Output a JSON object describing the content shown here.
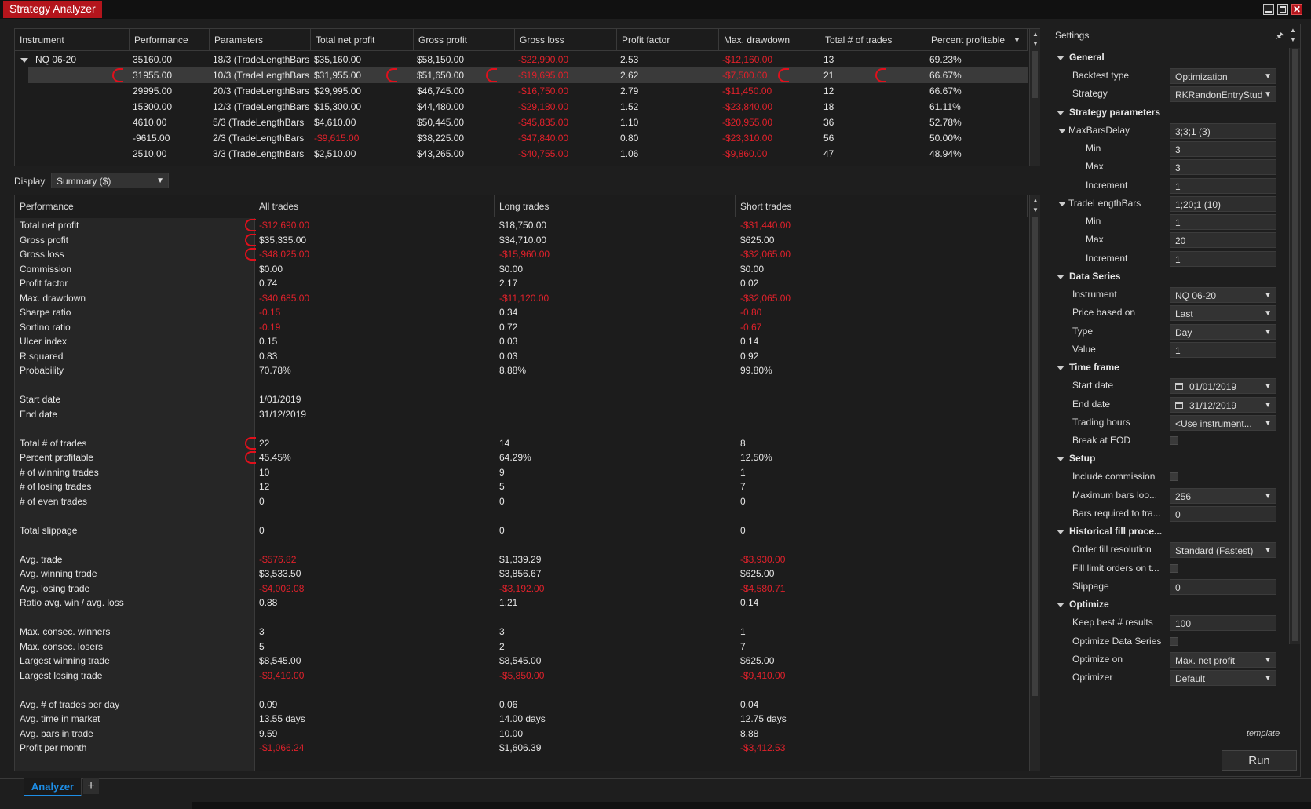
{
  "app": {
    "title": "Strategy Analyzer"
  },
  "top_table": {
    "columns": [
      "Instrument",
      "Performance",
      "Parameters",
      "Total net profit",
      "Gross profit",
      "Gross loss",
      "Profit factor",
      "Max. drawdown",
      "Total # of trades",
      "Percent profitable"
    ],
    "group": "NQ 06-20",
    "rows": [
      {
        "perf": "35160.00",
        "params": "18/3 (TradeLengthBars",
        "net": "$35,160.00",
        "gross": "$58,150.00",
        "loss": "-$22,990.00",
        "pf": "2.53",
        "dd": "-$12,160.00",
        "trades": "13",
        "pct": "69.23%"
      },
      {
        "perf": "31955.00",
        "params": "10/3 (TradeLengthBars",
        "net": "$31,955.00",
        "gross": "$51,650.00",
        "loss": "-$19,695.00",
        "pf": "2.62",
        "dd": "-$7,500.00",
        "trades": "21",
        "pct": "66.67%"
      },
      {
        "perf": "29995.00",
        "params": "20/3 (TradeLengthBars",
        "net": "$29,995.00",
        "gross": "$46,745.00",
        "loss": "-$16,750.00",
        "pf": "2.79",
        "dd": "-$11,450.00",
        "trades": "12",
        "pct": "66.67%"
      },
      {
        "perf": "15300.00",
        "params": "12/3 (TradeLengthBars",
        "net": "$15,300.00",
        "gross": "$44,480.00",
        "loss": "-$29,180.00",
        "pf": "1.52",
        "dd": "-$23,840.00",
        "trades": "18",
        "pct": "61.11%"
      },
      {
        "perf": "4610.00",
        "params": "5/3 (TradeLengthBars",
        "net": "$4,610.00",
        "gross": "$50,445.00",
        "loss": "-$45,835.00",
        "pf": "1.10",
        "dd": "-$20,955.00",
        "trades": "36",
        "pct": "52.78%"
      },
      {
        "perf": "-9615.00",
        "params": "2/3 (TradeLengthBars",
        "net": "-$9,615.00",
        "gross": "$38,225.00",
        "loss": "-$47,840.00",
        "pf": "0.80",
        "dd": "-$23,310.00",
        "trades": "56",
        "pct": "50.00%"
      },
      {
        "perf": "2510.00",
        "params": "3/3 (TradeLengthBars",
        "net": "$2,510.00",
        "gross": "$43,265.00",
        "loss": "-$40,755.00",
        "pf": "1.06",
        "dd": "-$9,860.00",
        "trades": "47",
        "pct": "48.94%"
      }
    ]
  },
  "display": {
    "label": "Display",
    "value": "Summary ($)"
  },
  "perf_table": {
    "columns": [
      "Performance",
      "All trades",
      "Long trades",
      "Short trades"
    ],
    "rows": [
      [
        "Total net profit",
        "-$12,690.00",
        "$18,750.00",
        "-$31,440.00"
      ],
      [
        "Gross profit",
        "$35,335.00",
        "$34,710.00",
        "$625.00"
      ],
      [
        "Gross loss",
        "-$48,025.00",
        "-$15,960.00",
        "-$32,065.00"
      ],
      [
        "Commission",
        "$0.00",
        "$0.00",
        "$0.00"
      ],
      [
        "Profit factor",
        "0.74",
        "2.17",
        "0.02"
      ],
      [
        "Max. drawdown",
        "-$40,685.00",
        "-$11,120.00",
        "-$32,065.00"
      ],
      [
        "Sharpe ratio",
        "-0.15",
        "0.34",
        "-0.80"
      ],
      [
        "Sortino ratio",
        "-0.19",
        "0.72",
        "-0.67"
      ],
      [
        "Ulcer index",
        "0.15",
        "0.03",
        "0.14"
      ],
      [
        "R squared",
        "0.83",
        "0.03",
        "0.92"
      ],
      [
        "Probability",
        "70.78%",
        "8.88%",
        "99.80%"
      ],
      [
        "",
        "",
        "",
        ""
      ],
      [
        "Start date",
        "1/01/2019",
        "",
        ""
      ],
      [
        "End date",
        "31/12/2019",
        "",
        ""
      ],
      [
        "",
        "",
        "",
        ""
      ],
      [
        "Total # of trades",
        "22",
        "14",
        "8"
      ],
      [
        "Percent profitable",
        "45.45%",
        "64.29%",
        "12.50%"
      ],
      [
        "# of winning trades",
        "10",
        "9",
        "1"
      ],
      [
        "# of losing trades",
        "12",
        "5",
        "7"
      ],
      [
        "# of even trades",
        "0",
        "0",
        "0"
      ],
      [
        "",
        "",
        "",
        ""
      ],
      [
        "Total slippage",
        "0",
        "0",
        "0"
      ],
      [
        "",
        "",
        "",
        ""
      ],
      [
        "Avg. trade",
        "-$576.82",
        "$1,339.29",
        "-$3,930.00"
      ],
      [
        "Avg. winning trade",
        "$3,533.50",
        "$3,856.67",
        "$625.00"
      ],
      [
        "Avg. losing trade",
        "-$4,002.08",
        "-$3,192.00",
        "-$4,580.71"
      ],
      [
        "Ratio avg. win / avg. loss",
        "0.88",
        "1.21",
        "0.14"
      ],
      [
        "",
        "",
        "",
        ""
      ],
      [
        "Max. consec. winners",
        "3",
        "3",
        "1"
      ],
      [
        "Max. consec. losers",
        "5",
        "2",
        "7"
      ],
      [
        "Largest winning trade",
        "$8,545.00",
        "$8,545.00",
        "$625.00"
      ],
      [
        "Largest losing trade",
        "-$9,410.00",
        "-$5,850.00",
        "-$9,410.00"
      ],
      [
        "",
        "",
        "",
        ""
      ],
      [
        "Avg. # of trades per day",
        "0.09",
        "0.06",
        "0.04"
      ],
      [
        "Avg. time in market",
        "13.55 days",
        "14.00 days",
        "12.75 days"
      ],
      [
        "Avg. bars in trade",
        "9.59",
        "10.00",
        "8.88"
      ],
      [
        "Profit per month",
        "-$1,066.24",
        "$1,606.39",
        "-$3,412.53"
      ]
    ]
  },
  "settings": {
    "title": "Settings",
    "pin_glyph": "🖈",
    "items": [
      {
        "t": "cat",
        "label": "General"
      },
      {
        "t": "sel",
        "label": "Backtest type",
        "value": "Optimization"
      },
      {
        "t": "sel",
        "label": "Strategy",
        "value": "RKRandonEntryStud"
      },
      {
        "t": "cat",
        "label": "Strategy parameters"
      },
      {
        "t": "sub",
        "label": "MaxBarsDelay",
        "value": "3;3;1 (3)"
      },
      {
        "t": "inp",
        "label": "Min",
        "value": "3",
        "indent": 2
      },
      {
        "t": "inp",
        "label": "Max",
        "value": "3",
        "indent": 2
      },
      {
        "t": "inp",
        "label": "Increment",
        "value": "1",
        "indent": 2
      },
      {
        "t": "sub",
        "label": "TradeLengthBars",
        "value": "1;20;1 (10)"
      },
      {
        "t": "inp",
        "label": "Min",
        "value": "1",
        "indent": 2
      },
      {
        "t": "inp",
        "label": "Max",
        "value": "20",
        "indent": 2
      },
      {
        "t": "inp",
        "label": "Increment",
        "value": "1",
        "indent": 2
      },
      {
        "t": "cat",
        "label": "Data Series"
      },
      {
        "t": "sel",
        "label": "Instrument",
        "value": "NQ 06-20"
      },
      {
        "t": "sel",
        "label": "Price based on",
        "value": "Last"
      },
      {
        "t": "sel",
        "label": "Type",
        "value": "Day"
      },
      {
        "t": "inp",
        "label": "Value",
        "value": "1"
      },
      {
        "t": "cat",
        "label": "Time frame"
      },
      {
        "t": "date",
        "label": "Start date",
        "value": "01/01/2019"
      },
      {
        "t": "date",
        "label": "End date",
        "value": "31/12/2019"
      },
      {
        "t": "sel",
        "label": "Trading hours",
        "value": "<Use instrument..."
      },
      {
        "t": "chk",
        "label": "Break at EOD"
      },
      {
        "t": "cat",
        "label": "Setup"
      },
      {
        "t": "chk",
        "label": "Include commission"
      },
      {
        "t": "sel",
        "label": "Maximum bars loo...",
        "value": "256"
      },
      {
        "t": "inp",
        "label": "Bars required to tra...",
        "value": "0"
      },
      {
        "t": "cat",
        "label": "Historical fill proce..."
      },
      {
        "t": "sel",
        "label": "Order fill resolution",
        "value": "Standard (Fastest)"
      },
      {
        "t": "chk",
        "label": "Fill limit orders on t..."
      },
      {
        "t": "inp",
        "label": "Slippage",
        "value": "0"
      },
      {
        "t": "cat",
        "label": "Optimize"
      },
      {
        "t": "inp",
        "label": "Keep best # results",
        "value": "100"
      },
      {
        "t": "chk",
        "label": "Optimize Data Series"
      },
      {
        "t": "sel",
        "label": "Optimize on",
        "value": "Max. net profit"
      },
      {
        "t": "sel",
        "label": "Optimizer",
        "value": "Default"
      }
    ],
    "template_label": "template",
    "run_label": "Run"
  },
  "tabs": {
    "active": "Analyzer",
    "add": "+"
  },
  "colors": {
    "negative": "#e0212b",
    "accent_red": "#b4151c",
    "tab_blue": "#1e8ee6",
    "annotation": "#e0101c"
  }
}
